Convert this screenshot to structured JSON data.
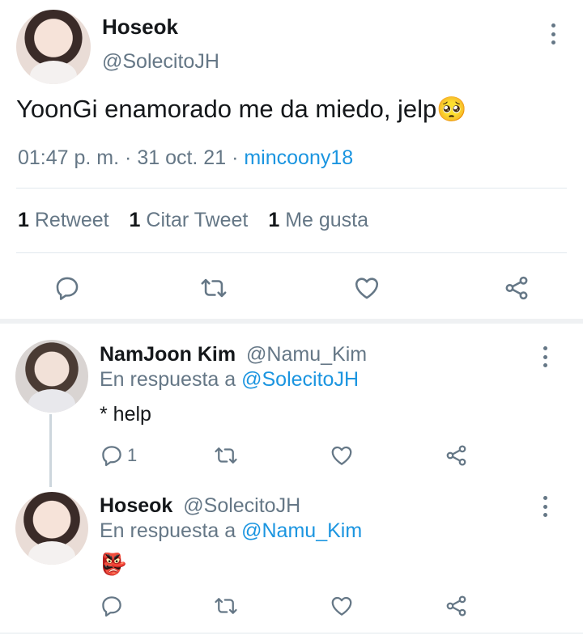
{
  "main_tweet": {
    "display_name": "Hoseok",
    "handle": "@SolecitoJH",
    "text": "YoonGi enamorado me da miedo, jelp",
    "emoji": "🥺",
    "time": "01:47 p. m.",
    "date": "31 oct. 21",
    "separator": "·",
    "source": "mincoony18",
    "stats": {
      "retweets_count": "1",
      "retweets_label": "Retweet",
      "quotes_count": "1",
      "quotes_label": "Citar Tweet",
      "likes_count": "1",
      "likes_label": "Me gusta"
    }
  },
  "replies": [
    {
      "display_name": "NamJoon Kim",
      "handle": "@Namu_Kim",
      "reply_prefix": "En respuesta a",
      "reply_to": "@SolecitoJH",
      "text": "* help",
      "reply_count": "1"
    },
    {
      "display_name": "Hoseok",
      "handle": "@SolecitoJH",
      "reply_prefix": "En respuesta a",
      "reply_to": "@Namu_Kim",
      "text": "👺",
      "reply_count": ""
    }
  ],
  "colors": {
    "link": "#1b95e0",
    "muted": "#657786",
    "divider": "#e1e8ed"
  }
}
